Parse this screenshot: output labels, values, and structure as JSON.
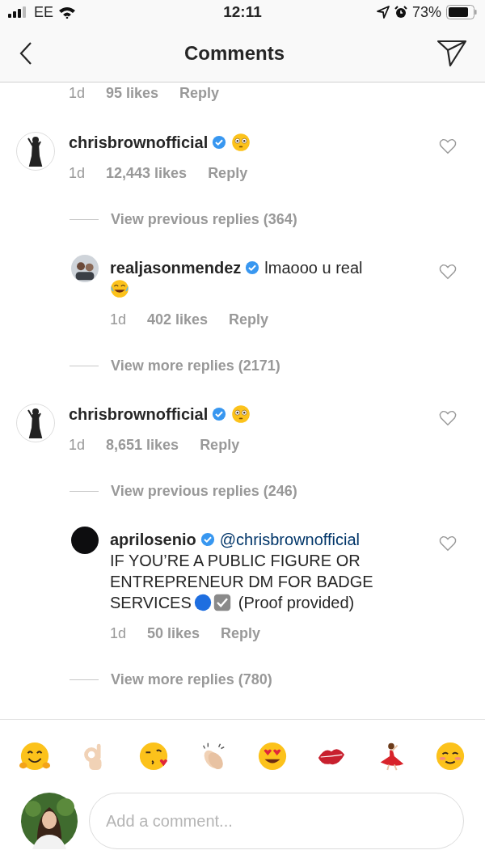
{
  "status_bar": {
    "carrier": "EE",
    "time": "12:11",
    "battery": "73%"
  },
  "nav": {
    "title": "Comments"
  },
  "comments": [
    {
      "kind": "partial",
      "time": "1d",
      "likes": "95 likes",
      "reply": "Reply"
    },
    {
      "kind": "comment",
      "user": "chrisbrownofficial",
      "verified": true,
      "liked": false,
      "lines": [
        [
          {
            "kind": "flushed"
          }
        ]
      ],
      "time": "1d",
      "likes": "12,443 likes",
      "reply": "Reply"
    },
    {
      "kind": "more",
      "text": "View previous replies (364)"
    },
    {
      "kind": "reply",
      "user": "realjasonmendez",
      "verified": true,
      "liked": false,
      "lines": [
        [
          {
            "kind": "text",
            "text": "lmaooo u real"
          }
        ],
        [
          {
            "kind": "laughing"
          }
        ]
      ],
      "time": "1d",
      "likes": "402 likes",
      "reply": "Reply"
    },
    {
      "kind": "more",
      "text": "View more replies (2171)"
    },
    {
      "kind": "comment",
      "user": "chrisbrownofficial",
      "verified": true,
      "liked": false,
      "lines": [
        [
          {
            "kind": "flushed"
          }
        ]
      ],
      "time": "1d",
      "likes": "8,651 likes",
      "reply": "Reply"
    },
    {
      "kind": "more",
      "text": "View previous replies (246)"
    },
    {
      "kind": "reply",
      "user": "aprilosenio",
      "verified": true,
      "liked": false,
      "lines": [
        [
          {
            "kind": "mention",
            "text": "@chrisbrownofficial"
          }
        ],
        [
          {
            "kind": "text",
            "text": "IF YOU’RE A PUBLIC FIGURE OR ENTREPRENEUR DM FOR BADGE"
          }
        ],
        [
          {
            "kind": "text",
            "text": "SERVICES"
          },
          {
            "kind": "blue-circle"
          },
          {
            "kind": "check-box"
          },
          {
            "kind": "text",
            "text": "(Proof provided)"
          }
        ]
      ],
      "time": "1d",
      "likes": "50 likes",
      "reply": "Reply"
    },
    {
      "kind": "more",
      "text": "View more replies (780)"
    }
  ],
  "emoji_bar": [
    {
      "kind": "hug"
    },
    {
      "kind": "ok-hand"
    },
    {
      "kind": "kiss"
    },
    {
      "kind": "clap"
    },
    {
      "kind": "heart-eyes"
    },
    {
      "kind": "lips"
    },
    {
      "kind": "dancer"
    },
    {
      "kind": "smiling"
    }
  ],
  "composer": {
    "placeholder": "Add a comment..."
  }
}
